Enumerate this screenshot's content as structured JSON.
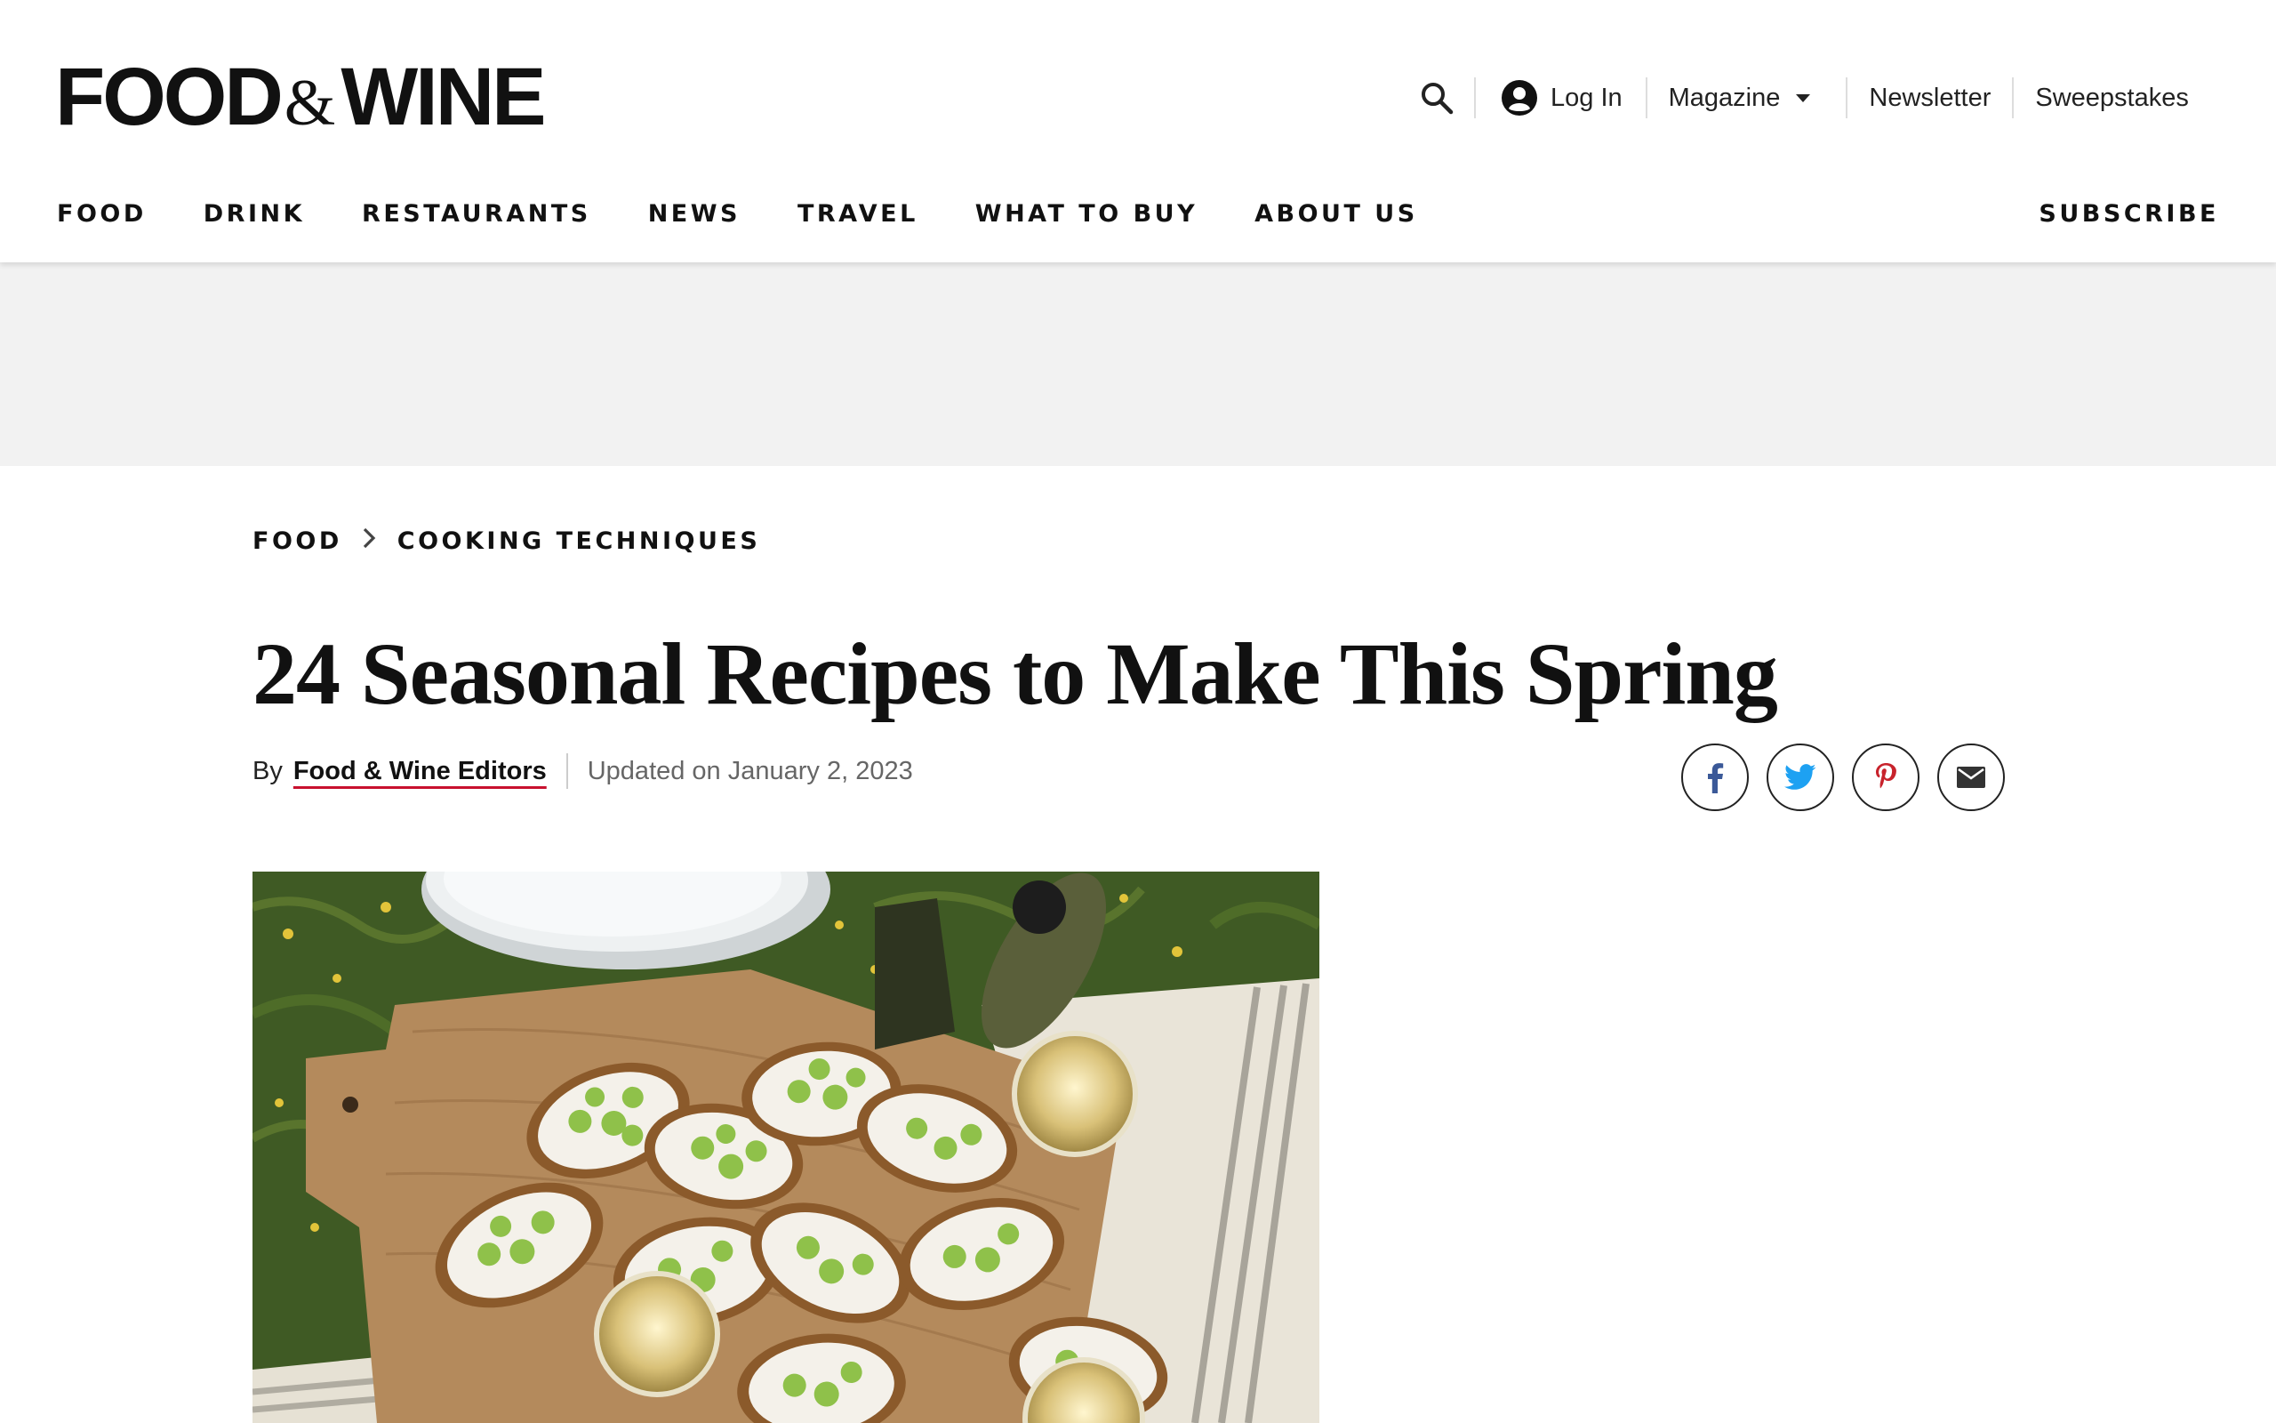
{
  "header": {
    "logo": {
      "left": "FOOD",
      "amp": "&",
      "right": "WINE"
    },
    "utility": {
      "search_icon": "search-icon",
      "login_label": "Log In",
      "magazine_label": "Magazine",
      "newsletter_label": "Newsletter",
      "sweepstakes_label": "Sweepstakes"
    },
    "nav": [
      "FOOD",
      "DRINK",
      "RESTAURANTS",
      "NEWS",
      "TRAVEL",
      "WHAT TO BUY",
      "ABOUT US"
    ],
    "subscribe_label": "SUBSCRIBE"
  },
  "breadcrumb": [
    "FOOD",
    "COOKING TECHNIQUES"
  ],
  "article": {
    "title": "24 Seasonal Recipes to Make This Spring",
    "by_label": "By",
    "author": "Food & Wine Editors",
    "updated": "Updated on January 2, 2023"
  },
  "social": [
    "facebook-icon",
    "twitter-icon",
    "pinterest-icon",
    "email-icon"
  ],
  "colors": {
    "accent_underline": "#c8102e",
    "ad_band": "#f2f2f2",
    "facebook": "#3b5998",
    "twitter": "#1da1f2",
    "pinterest": "#c8232c"
  }
}
